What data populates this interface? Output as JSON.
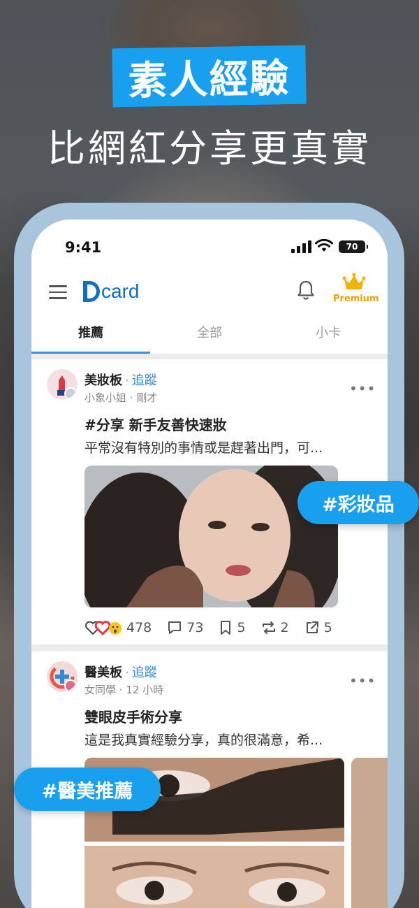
{
  "promo": {
    "badge": "素人經驗",
    "subtitle": "比網紅分享更真實"
  },
  "statusbar": {
    "time": "9:41",
    "battery": "70"
  },
  "header": {
    "logo_text": "card",
    "premium_label": "Premium"
  },
  "tabs": [
    {
      "label": "推薦",
      "active": true
    },
    {
      "label": "全部",
      "active": false
    },
    {
      "label": "小卡",
      "active": false
    }
  ],
  "posts": [
    {
      "forum": "美妝板",
      "follow": "追蹤",
      "author": "小象小姐",
      "time": "剛才",
      "title": "#分享 新手友善快速妝",
      "excerpt": "平常沒有特別的事情或是趕著出門，可...",
      "stats": {
        "reactions": "478",
        "comments": "73",
        "saves": "5",
        "reposts": "2",
        "shares": "5"
      }
    },
    {
      "forum": "醫美板",
      "follow": "追蹤",
      "author": "女同學",
      "time": "12 小時",
      "title": "雙眼皮手術分享",
      "excerpt": "這是我真實經驗分享，真的很滿意，希..."
    }
  ],
  "floating_tags": [
    "#彩妝品",
    "#醫美推薦"
  ],
  "colors": {
    "accent": "#18a0ee",
    "brand": "#0b70c4",
    "premium": "#e8a400",
    "follow": "#2f8ad8"
  }
}
